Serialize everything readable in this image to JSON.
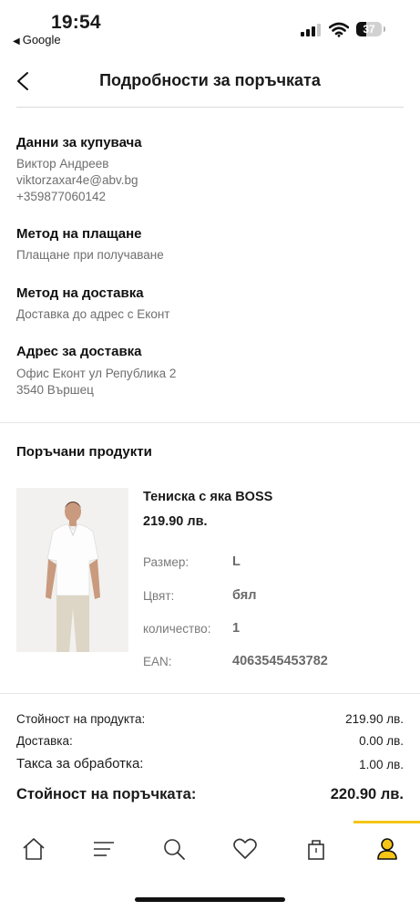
{
  "status_bar": {
    "time": "19:54",
    "back_app": "Google",
    "battery": "37"
  },
  "header": {
    "title": "Подробности за поръчката"
  },
  "buyer": {
    "title": "Данни за купувача",
    "name": "Виктор Андреев",
    "email": "viktorzaxar4e@abv.bg",
    "phone": "+359877060142"
  },
  "payment": {
    "title": "Метод на плащане",
    "value": "Плащане при получаване"
  },
  "delivery": {
    "title": "Метод на доставка",
    "value": "Доставка до адрес с Еконт"
  },
  "address": {
    "title": "Адрес за доставка",
    "line1": "Офис Еконт  ул Република 2",
    "line2": "3540 Вършец"
  },
  "products": {
    "title": "Поръчани продукти",
    "items": [
      {
        "name": "Тениска с яка BOSS",
        "price": "219.90 лв.",
        "attributes": [
          {
            "label": "Размер:",
            "value": "L"
          },
          {
            "label": "Цвят:",
            "value": "бял"
          },
          {
            "label": "количество:",
            "value": "1"
          },
          {
            "label": "EAN:",
            "value": "4063545453782"
          }
        ]
      }
    ]
  },
  "totals": {
    "rows": [
      {
        "label": "Стойност на продукта:",
        "value": "219.90 лв."
      },
      {
        "label": "Доставка:",
        "value": "0.00 лв."
      },
      {
        "label": "Такса за обработка:",
        "value": "1.00 лв."
      }
    ],
    "grand_label": "Стойност на поръчката:",
    "grand_value": "220.90 лв."
  },
  "nav": {
    "items": [
      "home-icon",
      "menu-icon",
      "search-icon",
      "heart-icon",
      "bag-icon",
      "user-icon"
    ],
    "active": "user-icon",
    "accent_color": "#f5c518"
  }
}
